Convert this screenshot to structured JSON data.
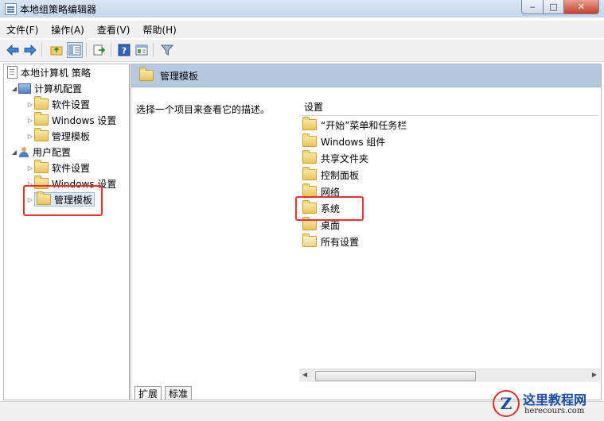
{
  "window": {
    "title": "本地组策略编辑器",
    "controls": {
      "minimize": "‒",
      "maximize": "□",
      "close": "✕"
    }
  },
  "menu": [
    "文件(F)",
    "操作(A)",
    "查看(V)",
    "帮助(H)"
  ],
  "toolbar": {
    "icons": [
      "back-arrow-icon",
      "forward-arrow-icon",
      "up-folder-icon",
      "show-hide-tree-icon",
      "export-list-icon",
      "help-icon",
      "properties-icon",
      "filter-icon"
    ],
    "active": "show-hide-tree-icon"
  },
  "tree": {
    "root": "本地计算机 策略",
    "computer": {
      "label": "计算机配置",
      "children": [
        "软件设置",
        "Windows 设置",
        "管理模板"
      ]
    },
    "user": {
      "label": "用户配置",
      "children": [
        "软件设置",
        "Windows 设置",
        "管理模板"
      ]
    },
    "selected": "管理模板"
  },
  "right": {
    "header": "管理模板",
    "description": "选择一个项目来查看它的描述。",
    "column": "设置",
    "items": [
      "“开始”菜单和任务栏",
      "Windows 组件",
      "共享文件夹",
      "控制面板",
      "网络",
      "系统",
      "桌面",
      "所有设置"
    ],
    "highlighted": "系统",
    "tabs": [
      "扩展",
      "标准"
    ],
    "active_tab": "扩展"
  },
  "watermark": {
    "logo_letter": "Z",
    "title": "这里教程网",
    "url": "herecours.com"
  },
  "colors": {
    "highlight_box": "#e8322f",
    "header_band": "#b4c9df",
    "selection": "#dde9f7"
  }
}
